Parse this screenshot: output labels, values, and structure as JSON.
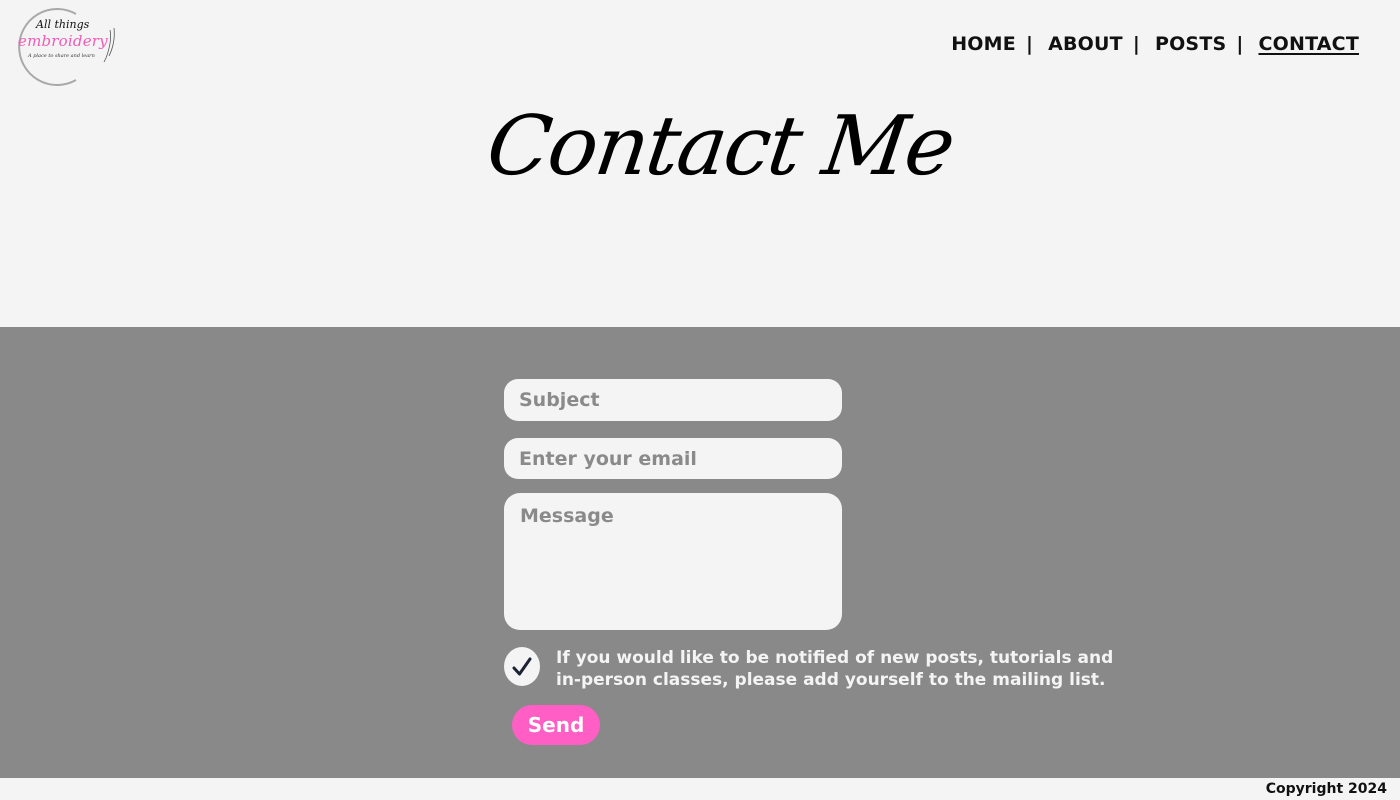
{
  "brand": {
    "logo_line1": "All things",
    "logo_line2": "embroidery",
    "logo_tagline": "A place to share and learn"
  },
  "nav": {
    "items": [
      {
        "label": "HOME",
        "active": false
      },
      {
        "label": "ABOUT",
        "active": false
      },
      {
        "label": "POSTS",
        "active": false
      },
      {
        "label": "CONTACT",
        "active": true
      }
    ],
    "separator": "|"
  },
  "page": {
    "title": "Contact Me"
  },
  "form": {
    "subject_placeholder": "Subject",
    "email_placeholder": "Enter your email",
    "message_placeholder": "Message",
    "mailing_list_checked": true,
    "mailing_list_label": "If you would like to be notified of new posts, tutorials and in-person classes, please add yourself to the mailing list.",
    "send_label": "Send"
  },
  "footer": {
    "copyright": "Copyright 2024"
  },
  "colors": {
    "accent_pink": "#ff5fc5",
    "logo_pink": "#f25bb8",
    "form_background": "#898989",
    "page_background": "#f4f4f4"
  },
  "icons": {
    "checkbox": "check-icon"
  }
}
